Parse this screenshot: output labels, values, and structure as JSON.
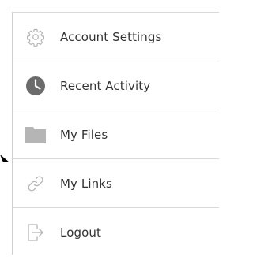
{
  "menu": {
    "items": [
      {
        "label": "Account Settings",
        "icon": "gear-icon"
      },
      {
        "label": "Recent Activity",
        "icon": "clock-icon"
      },
      {
        "label": "My Files",
        "icon": "folder-icon"
      },
      {
        "label": "My Links",
        "icon": "link-icon"
      },
      {
        "label": "Logout",
        "icon": "logout-icon"
      }
    ]
  },
  "colors": {
    "text": "#333333",
    "icon_light": "#b5b5b5",
    "icon_dark": "#6b6b6b",
    "divider": "#d9d9d9"
  }
}
